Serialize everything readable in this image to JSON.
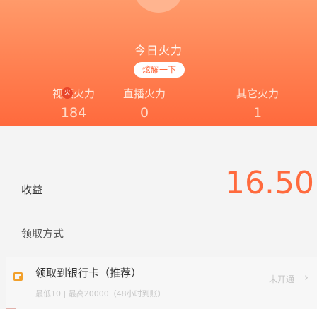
{
  "header": {
    "title": "今日火力",
    "flaunt_button": "炫耀一下",
    "fire_badge": "火"
  },
  "stats": [
    {
      "label": "视频火力",
      "value": "184"
    },
    {
      "label": "直播火力",
      "value": "0"
    },
    {
      "label": "其它火力",
      "value": "1"
    }
  ],
  "balance": {
    "label": "收益",
    "value": "16.50"
  },
  "withdraw": {
    "section_label": "领取方式",
    "method_name": "领取到银行卡（推荐）",
    "method_limit": "最低10 | 最高20000（48小时到账）",
    "bind_status": "未开通",
    "chevron": "›"
  },
  "colors": {
    "accent": "#ff6a3d",
    "hero_gradient_top": "#ff9a6a",
    "hero_gradient_bottom": "#ff6a3d",
    "wallet_icon": "#f2a02b"
  }
}
